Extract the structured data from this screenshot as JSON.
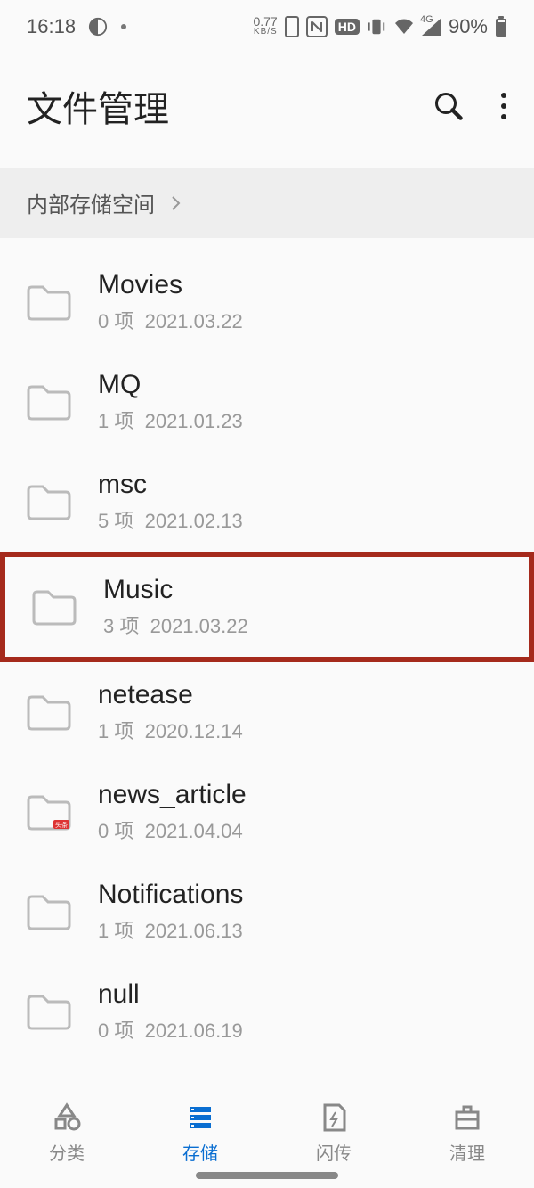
{
  "statusbar": {
    "time": "16:18",
    "net_speed": "0.77",
    "net_unit": "KB/S",
    "hd_label": "HD",
    "net_type": "4G",
    "battery": "90%"
  },
  "header": {
    "title": "文件管理"
  },
  "breadcrumb": {
    "root": "内部存储空间"
  },
  "folders": [
    {
      "name": "Movies",
      "count": "0 项",
      "date": "2021.03.22",
      "badge": false,
      "highlight": false
    },
    {
      "name": "MQ",
      "count": "1 项",
      "date": "2021.01.23",
      "badge": false,
      "highlight": false
    },
    {
      "name": "msc",
      "count": "5 项",
      "date": "2021.02.13",
      "badge": false,
      "highlight": false
    },
    {
      "name": "Music",
      "count": "3 项",
      "date": "2021.03.22",
      "badge": false,
      "highlight": true
    },
    {
      "name": "netease",
      "count": "1 项",
      "date": "2020.12.14",
      "badge": false,
      "highlight": false
    },
    {
      "name": "news_article",
      "count": "0 项",
      "date": "2021.04.04",
      "badge": true,
      "highlight": false
    },
    {
      "name": "Notifications",
      "count": "1 项",
      "date": "2021.06.13",
      "badge": false,
      "highlight": false
    },
    {
      "name": "null",
      "count": "0 项",
      "date": "2021.06.19",
      "badge": false,
      "highlight": false
    }
  ],
  "tabs": [
    {
      "label": "分类",
      "active": false
    },
    {
      "label": "存储",
      "active": true
    },
    {
      "label": "闪传",
      "active": false
    },
    {
      "label": "清理",
      "active": false
    }
  ]
}
